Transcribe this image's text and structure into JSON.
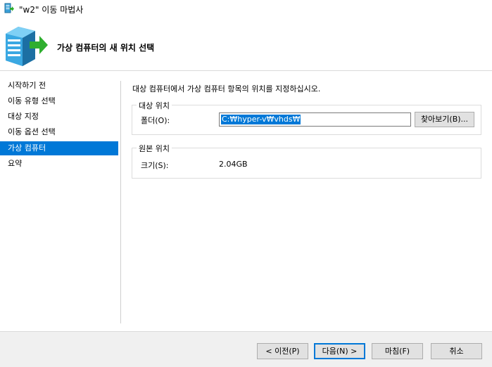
{
  "window": {
    "title": "\"w2\" 이동 마법사",
    "header_title": "가상 컴퓨터의 새 위치 선택"
  },
  "nav": {
    "items": [
      {
        "label": "시작하기 전",
        "selected": false
      },
      {
        "label": "이동 유형 선택",
        "selected": false
      },
      {
        "label": "대상 지정",
        "selected": false
      },
      {
        "label": "이동 옵션 선택",
        "selected": false
      },
      {
        "label": "가상 컴퓨터",
        "selected": true
      },
      {
        "label": "요약",
        "selected": false
      }
    ]
  },
  "main": {
    "instruction": "대상 컴퓨터에서 가상 컴퓨터 항목의 위치를 지정하십시오.",
    "destination": {
      "legend": "대상 위치",
      "folder_label": "폴더(O):",
      "folder_value": "C:₩hyper-v₩vhds₩",
      "browse_label": "찾아보기(B)..."
    },
    "source": {
      "legend": "원본 위치",
      "size_label": "크기(S):",
      "size_value": "2.04GB"
    }
  },
  "footer": {
    "prev_label": "< 이전(P)",
    "next_label": "다음(N) >",
    "finish_label": "마침(F)",
    "cancel_label": "취소"
  },
  "colors": {
    "accent": "#0078d7",
    "icon_green": "#2fae2f",
    "server_blue": "#3aa0d8"
  },
  "icons": {
    "app": "migrate-app-icon",
    "banner": "server-move-icon"
  }
}
